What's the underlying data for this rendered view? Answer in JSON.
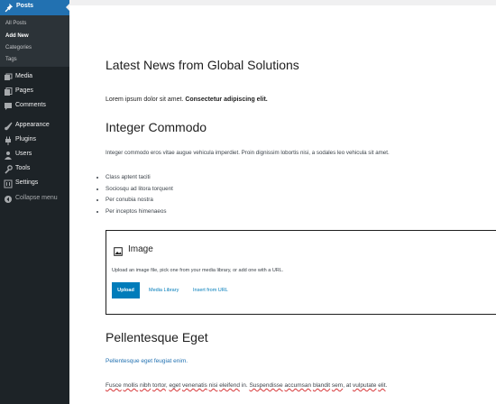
{
  "sidebar": {
    "active_menu": "Posts",
    "submenu": [
      "All Posts",
      "Add New",
      "Categories",
      "Tags"
    ],
    "items": [
      "Media",
      "Pages",
      "Comments",
      "Appearance",
      "Plugins",
      "Users",
      "Tools",
      "Settings"
    ],
    "collapse_label": "Collapse menu"
  },
  "editor": {
    "post_title": "Latest News from Global Solutions",
    "paragraph1_normal": "Lorem ipsum dolor sit amet. ",
    "paragraph1_bold": "Consectetur adipiscing elit.",
    "heading1": "Integer Commodo",
    "paragraph2": "Integer commodo eros vitae augue vehicula imperdiet. Proin dignissim lobortis nisi, a sodales leo vehicula sit amet.",
    "list": [
      "Class aptent taciti",
      "Sociosqu ad litora torquent",
      "Per conubia nostra",
      "Per inceptos himenaeos"
    ],
    "image_block": {
      "title": "Image",
      "description": "Upload an image file, pick one from your media library, or add one with a URL.",
      "upload_label": "Upload",
      "media_library_label": "Media Library",
      "insert_url_label": "Insert from URL"
    },
    "heading2": "Pellentesque Eget",
    "link_paragraph": "Pellentesque eget feugiat enim.",
    "paragraph3": [
      {
        "text": "Fusce",
        "spell": true
      },
      {
        "text": " ",
        "spell": false
      },
      {
        "text": "mollis",
        "spell": true
      },
      {
        "text": " ",
        "spell": false
      },
      {
        "text": "nibh",
        "spell": true
      },
      {
        "text": " ",
        "spell": false
      },
      {
        "text": "tortor",
        "spell": true
      },
      {
        "text": ", ",
        "spell": false
      },
      {
        "text": "eget",
        "spell": true
      },
      {
        "text": " ",
        "spell": false
      },
      {
        "text": "venenatis",
        "spell": true
      },
      {
        "text": " ",
        "spell": false
      },
      {
        "text": "nisi",
        "spell": true
      },
      {
        "text": " ",
        "spell": false
      },
      {
        "text": "eleifend",
        "spell": true
      },
      {
        "text": " in. ",
        "spell": false
      },
      {
        "text": "Suspendisse",
        "spell": true
      },
      {
        "text": " ",
        "spell": false
      },
      {
        "text": "accumsan",
        "spell": true
      },
      {
        "text": " ",
        "spell": false
      },
      {
        "text": "blandit",
        "spell": true
      },
      {
        "text": " ",
        "spell": false
      },
      {
        "text": "sem",
        "spell": true
      },
      {
        "text": ", at ",
        "spell": false
      },
      {
        "text": "vulputate",
        "spell": true
      },
      {
        "text": " ",
        "spell": false
      },
      {
        "text": "elit",
        "spell": true
      },
      {
        "text": ".",
        "spell": false
      }
    ]
  },
  "colors": {
    "sidebar_bg": "#1d2327",
    "sidebar_active": "#2271b1",
    "link": "#2271b1",
    "button": "#007cba",
    "spellcheck": "#d63638"
  }
}
